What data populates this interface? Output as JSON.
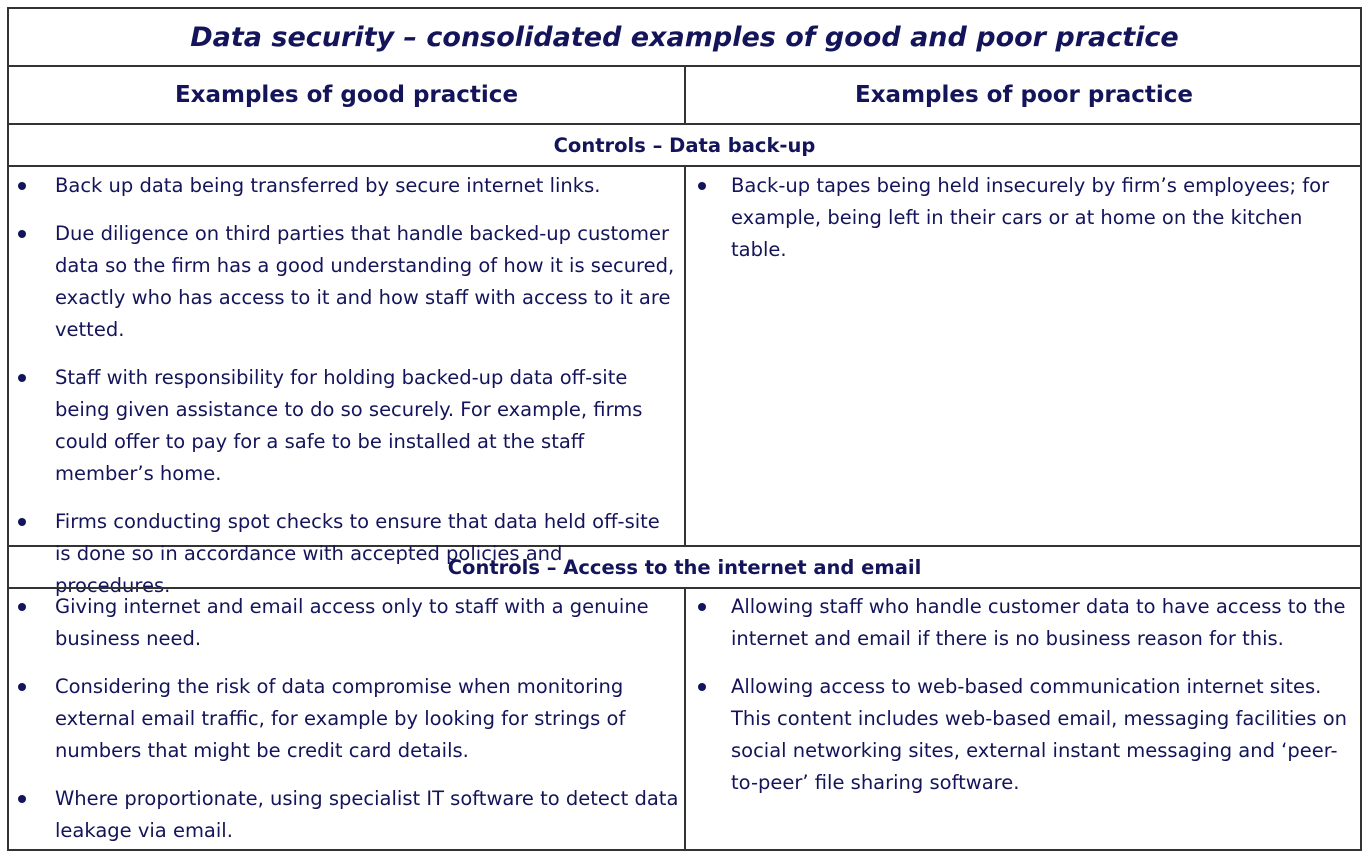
{
  "title": "Data security – consolidated examples of good and poor practice",
  "headers": {
    "good": "Examples of good practice",
    "poor": "Examples of poor practice"
  },
  "sections": [
    {
      "title": "Controls – Data back-up",
      "good": [
        "Back up data being transferred by secure internet links.",
        "Due diligence on third parties that handle backed-up customer data so the firm has a good understanding of how it is secured, exactly who has access to it and how staff with access to it are vetted.",
        "Staff with responsibility for holding backed-up data off-site being given assistance to do so securely. For example, firms could offer to pay for a safe to be installed at the staff member’s home.",
        "Firms conducting spot checks to ensure that data held off-site is done so in accordance with accepted policies and procedures."
      ],
      "poor": [
        "Back-up tapes being held insecurely by firm’s employees; for example, being left in their cars or at home on the kitchen table."
      ]
    },
    {
      "title": "Controls – Access to the internet and email",
      "good": [
        "Giving internet and email access only to staff with a genuine business need.",
        "Considering the risk of data compromise when monitoring external email traffic, for example by looking for strings of numbers that might be credit card details.",
        "Where proportionate, using specialist IT software to detect data leakage via email."
      ],
      "poor": [
        "Allowing staff who handle customer data to have access to the internet and email if there is no business reason for this.",
        "Allowing access to web-based communication internet sites. This content includes web-based email, messaging facilities on social networking sites, external instant messaging and ‘peer-to-peer’ file sharing software."
      ]
    }
  ]
}
